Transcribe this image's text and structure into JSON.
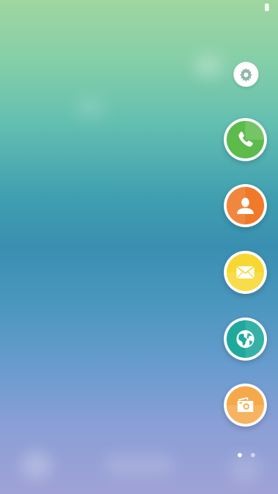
{
  "screen": {
    "title": "",
    "background_gradient": [
      "#9fd6a0",
      "#63bfb0",
      "#3a8fb0",
      "#6a9ccf",
      "#9fa2d6"
    ]
  },
  "status_bar": {
    "battery_icon": "battery-icon"
  },
  "edge_panel": {
    "settings": {
      "icon": "gear-icon",
      "color": "#8fb8a8"
    },
    "apps": [
      {
        "name": "phone",
        "icon": "phone-icon",
        "color": "#5dbb4c"
      },
      {
        "name": "contacts",
        "icon": "contact-icon",
        "color": "#f07a2a"
      },
      {
        "name": "email",
        "icon": "envelope-icon",
        "color": "#f7d832"
      },
      {
        "name": "internet",
        "icon": "globe-icon",
        "color": "#1fa99d"
      },
      {
        "name": "gallery",
        "icon": "camera-icon",
        "color": "#f6a94a"
      }
    ]
  },
  "page_indicator": {
    "pages": 2,
    "active_index": 0
  }
}
